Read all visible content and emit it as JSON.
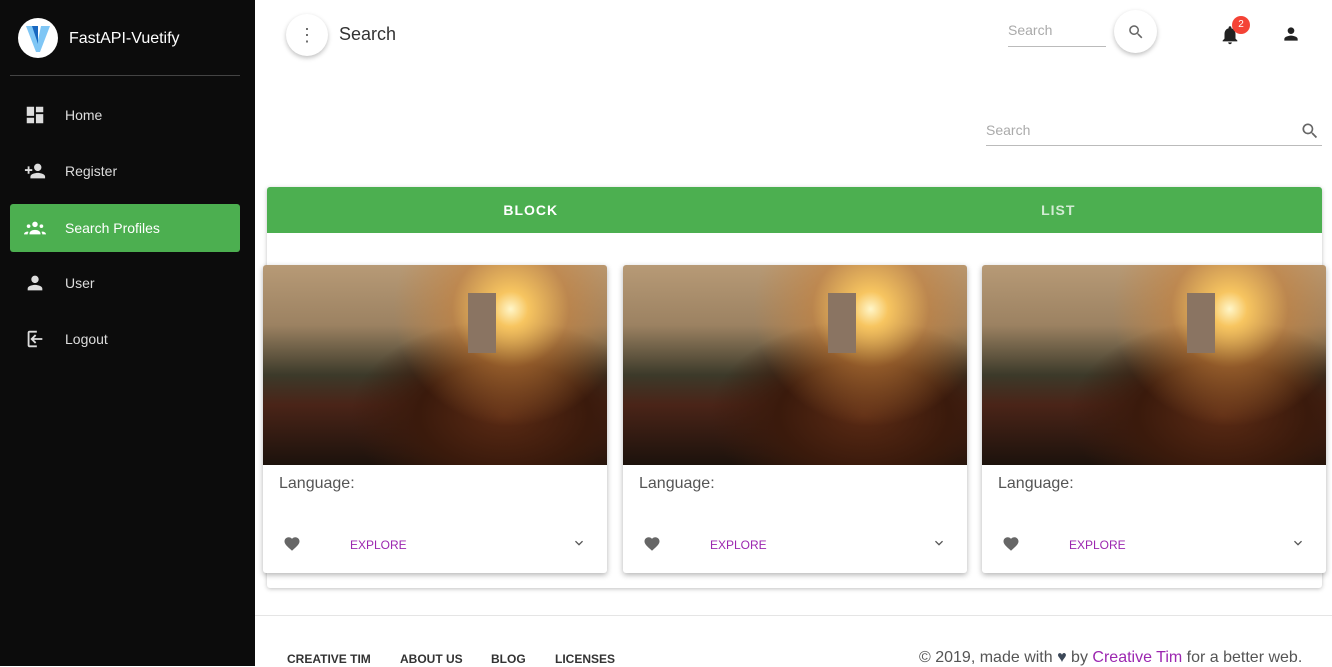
{
  "sidebar": {
    "brand": "FastAPI-Vuetify",
    "items": [
      {
        "label": "Home",
        "icon": "dashboard-icon"
      },
      {
        "label": "Register",
        "icon": "person-add-icon"
      },
      {
        "label": "Search Profiles",
        "icon": "people-icon",
        "active": true
      },
      {
        "label": "User",
        "icon": "person-icon"
      },
      {
        "label": "Logout",
        "icon": "logout-icon"
      }
    ]
  },
  "toolbar": {
    "title": "Search",
    "search_placeholder": "Search",
    "notifications": "2"
  },
  "main": {
    "search_placeholder": "Search",
    "tabs": [
      {
        "label": "BLOCK",
        "active": true
      },
      {
        "label": "LIST"
      }
    ],
    "cards": [
      {
        "label": "Language:",
        "action": "EXPLORE"
      },
      {
        "label": "Language:",
        "action": "EXPLORE"
      },
      {
        "label": "Language:",
        "action": "EXPLORE"
      }
    ]
  },
  "footer": {
    "links": [
      "CREATIVE TIM",
      "ABOUT US",
      "BLOG",
      "LICENSES"
    ],
    "copy_prefix": "© 2019, made with",
    "copy_by": "by",
    "copy_author": "Creative Tim",
    "copy_suffix": "for a better web."
  },
  "colors": {
    "accent": "#4caf50",
    "link": "#9c27b0",
    "badge": "#f44336"
  }
}
